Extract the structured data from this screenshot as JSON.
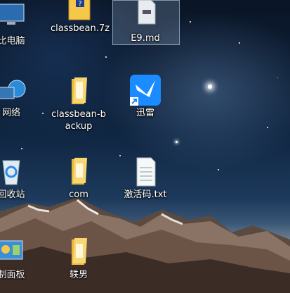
{
  "desktop": {
    "icons": [
      {
        "label": "比电脑",
        "icon": "computer-icon"
      },
      {
        "label": "classbean.7z",
        "icon": "archive-icon"
      },
      {
        "label": "E9.md",
        "icon": "markdown-file-icon",
        "selected": true
      },
      {
        "label": "网络",
        "icon": "network-icon"
      },
      {
        "label": "classbean-backup",
        "icon": "folder-icon"
      },
      {
        "label": "迅雷",
        "icon": "xunlei-bird-icon"
      },
      {
        "label": "回收站",
        "icon": "recycle-bin-icon"
      },
      {
        "label": "com",
        "icon": "folder-icon"
      },
      {
        "label": "激活码.txt",
        "icon": "text-file-icon"
      },
      {
        "label": "制面板",
        "icon": "control-panel-icon"
      },
      {
        "label": "轶男",
        "icon": "folder-icon"
      }
    ]
  },
  "colors": {
    "xunlei_blue": "#1a8cff",
    "folder_yellow": "#f5c84c",
    "selection": "#b4d2f0"
  }
}
